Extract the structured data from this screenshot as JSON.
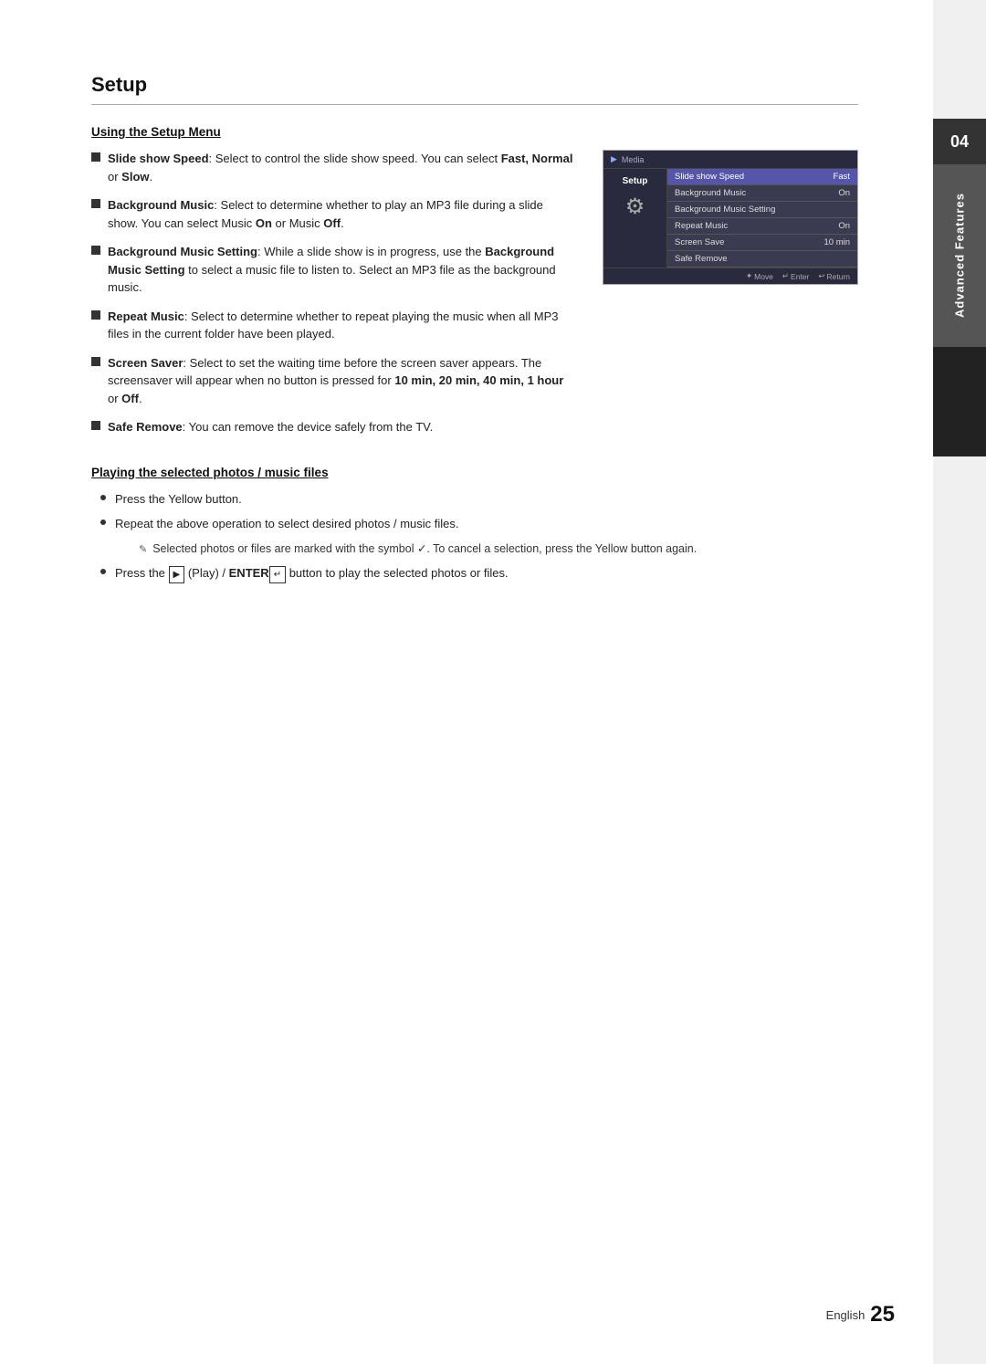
{
  "page": {
    "title": "Setup",
    "chapter_number": "04",
    "chapter_title": "Advanced Features",
    "footer_language": "English",
    "footer_page": "25"
  },
  "setup_section": {
    "heading": "Using the Setup Menu",
    "bullets": [
      {
        "label": "Slide show Speed",
        "text": ": Select to control the slide show speed. You can select ",
        "bold_options": "Fast, Normal",
        "text2": " or ",
        "bold_options2": "Slow",
        "text3": "."
      },
      {
        "label": "Background Music",
        "text": ": Select to determine whether to play an MP3 file during a slide show. You can select Music ",
        "bold_on": "On",
        "text2": " or Music ",
        "bold_off": "Off",
        "text3": "."
      },
      {
        "label": "Background Music Setting",
        "text": ": While a slide show is in progress, use the ",
        "bold_mid": "Background Music Setting",
        "text2": " to select a music file to listen to. Select an MP3 file as the background music."
      },
      {
        "label": "Repeat Music",
        "text": ": Select to determine whether to repeat playing the music when all MP3 files in the current folder have been played."
      },
      {
        "label": "Screen Saver",
        "text": ": Select to set the waiting time before the screen saver appears. The screensaver will appear when no button is pressed for ",
        "bold_opts": "10 min, 20 min, 40 min, 1 hour",
        "text2": " or ",
        "bold_off": "Off",
        "text3": "."
      },
      {
        "label": "Safe Remove",
        "text": ": You can remove the device safely from the TV."
      }
    ]
  },
  "screen_mockup": {
    "media_label": "Media",
    "setup_label": "Setup",
    "menu_items": [
      {
        "label": "Slide show Speed",
        "value": "Fast",
        "highlighted": true
      },
      {
        "label": "Background Music",
        "value": "On",
        "highlighted": false
      },
      {
        "label": "Background Music Setting",
        "value": "",
        "highlighted": false
      },
      {
        "label": "Repeat Music",
        "value": "On",
        "highlighted": false
      },
      {
        "label": "Screen Save",
        "value": "10 min",
        "highlighted": false
      },
      {
        "label": "Safe Remove",
        "value": "",
        "highlighted": false
      }
    ],
    "footer_move": "Move",
    "footer_enter": "Enter",
    "footer_return": "Return"
  },
  "playing_section": {
    "heading": "Playing the selected photos / music files",
    "bullets": [
      "Press the Yellow button.",
      "Repeat the above operation to select desired photos / music files.",
      "Press the  (Play) / ENTER  button to play the selected photos or files."
    ],
    "note_text": "Selected photos or files are marked with the symbol ✓. To cancel a selection, press the Yellow button again."
  }
}
